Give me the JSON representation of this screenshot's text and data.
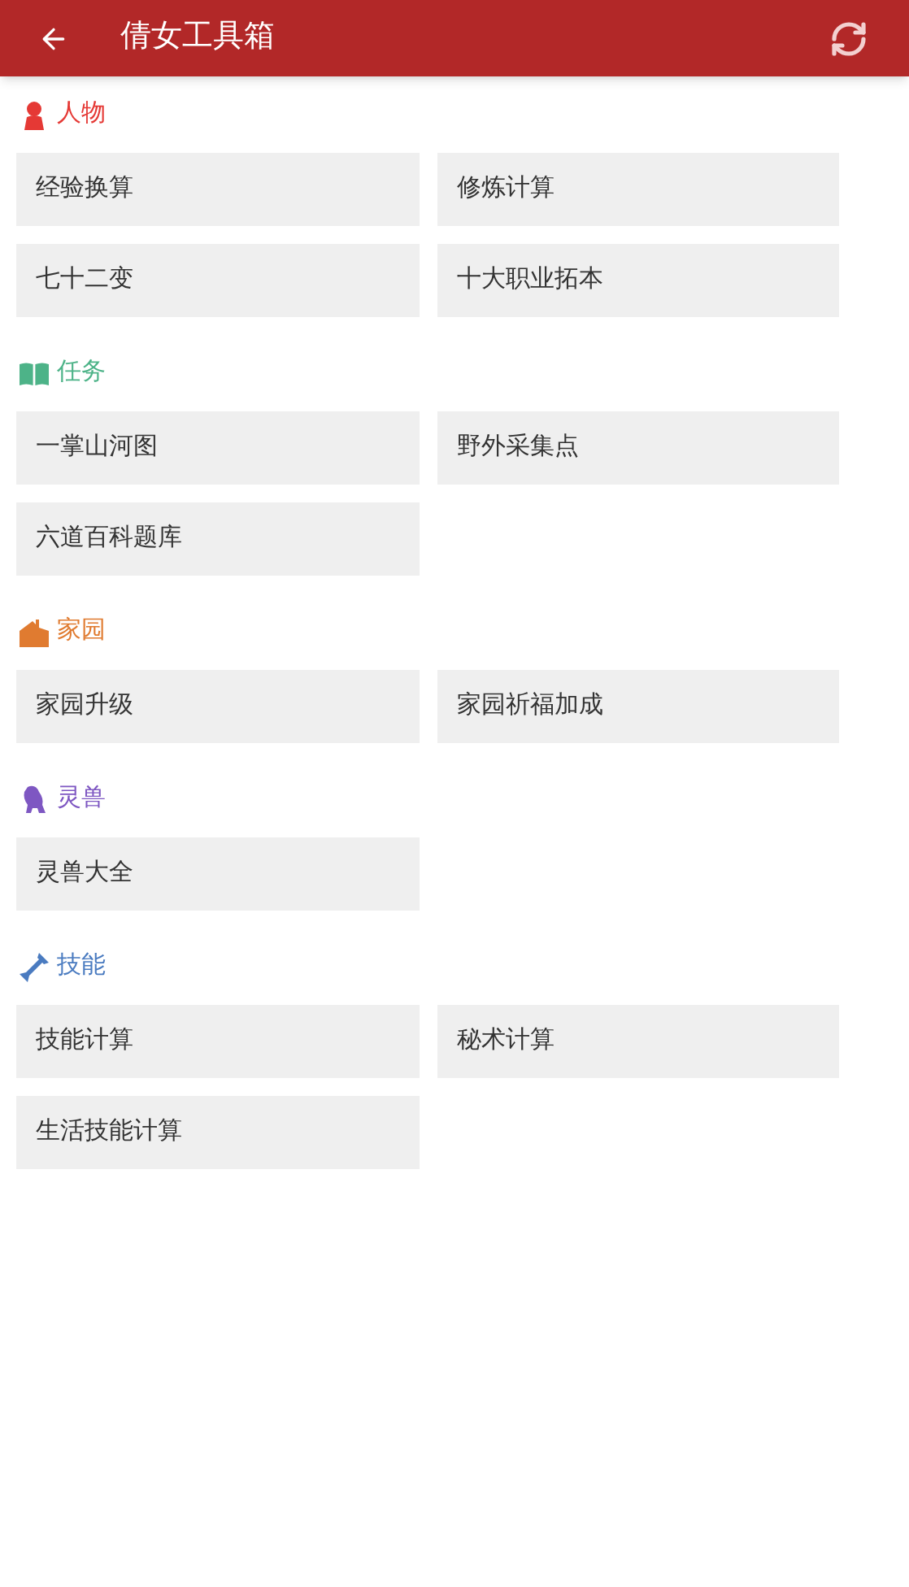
{
  "app_bar": {
    "title": "倩女工具箱"
  },
  "sections": [
    {
      "title": "人物",
      "kind": "person",
      "color": "#e53935",
      "items": [
        "经验换算",
        "修炼计算",
        "七十二变",
        "十大职业拓本"
      ]
    },
    {
      "title": "任务",
      "kind": "book",
      "color": "#4db388",
      "items": [
        "一掌山河图",
        "野外采集点",
        "六道百科题库"
      ]
    },
    {
      "title": "家园",
      "kind": "house",
      "color": "#e07b30",
      "items": [
        "家园升级",
        "家园祈福加成"
      ]
    },
    {
      "title": "灵兽",
      "kind": "beast",
      "color": "#7e57c2",
      "items": [
        "灵兽大全"
      ]
    },
    {
      "title": "技能",
      "kind": "tool",
      "color": "#4a7bc0",
      "items": [
        "技能计算",
        "秘术计算",
        "生活技能计算"
      ]
    }
  ]
}
